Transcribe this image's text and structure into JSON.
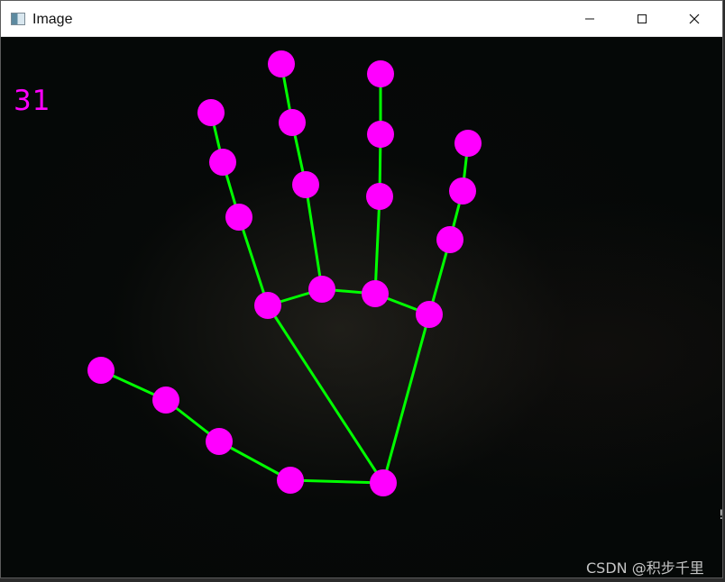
{
  "window": {
    "title": "Image",
    "controls": {
      "minimize": "minimize",
      "maximize": "maximize",
      "close": "close"
    }
  },
  "overlay": {
    "fps_value": "31",
    "watermark": "CSDN @积步千里",
    "edge_glyph": "!"
  },
  "hand": {
    "color_points": "#ff00ff",
    "color_lines": "#00ff00"
  }
}
